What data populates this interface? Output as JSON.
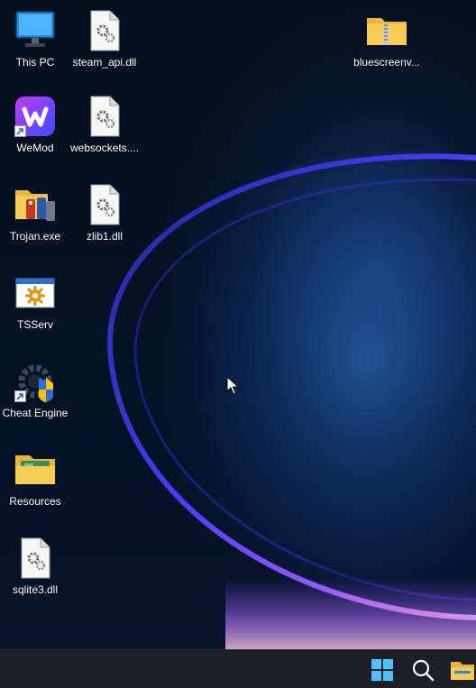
{
  "desktop": {
    "icons": [
      {
        "label": "This PC",
        "icon": "monitor-icon"
      },
      {
        "label": "steam_api.dll",
        "icon": "dll-file-icon"
      },
      {
        "label": "bluescreenv...",
        "icon": "zip-folder-icon"
      },
      {
        "label": "WeMod",
        "icon": "wemod-app-icon"
      },
      {
        "label": "websockets....",
        "icon": "dll-file-icon"
      },
      {
        "label": "Trojan.exe",
        "icon": "trojan-exe-icon"
      },
      {
        "label": "zlib1.dll",
        "icon": "dll-file-icon"
      },
      {
        "label": "TSServ",
        "icon": "tsserv-app-icon"
      },
      {
        "label": "Cheat Engine",
        "icon": "cheat-engine-icon"
      },
      {
        "label": "Resources",
        "icon": "folder-icon"
      },
      {
        "label": "sqlite3.dll",
        "icon": "dll-file-icon"
      }
    ]
  },
  "taskbar": {
    "buttons": [
      {
        "name": "start",
        "icon": "windows-start-icon"
      },
      {
        "name": "search",
        "icon": "search-icon"
      },
      {
        "name": "file-explorer",
        "icon": "file-explorer-icon"
      }
    ]
  },
  "colors": {
    "taskbar_bg": "#1c1f25",
    "folder_yellow": "#f3c64b",
    "windows_blue": "#3aa0f3",
    "wemod_purple": "#7a3cf0"
  }
}
